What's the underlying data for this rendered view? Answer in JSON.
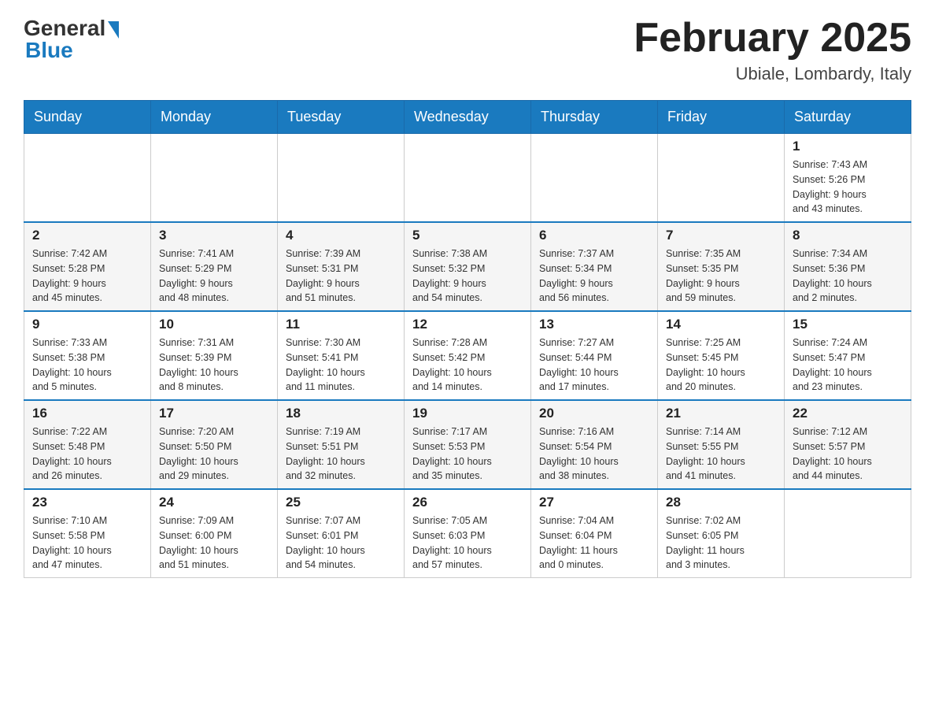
{
  "header": {
    "logo_general": "General",
    "logo_blue": "Blue",
    "month_year": "February 2025",
    "location": "Ubiale, Lombardy, Italy"
  },
  "weekdays": [
    "Sunday",
    "Monday",
    "Tuesday",
    "Wednesday",
    "Thursday",
    "Friday",
    "Saturday"
  ],
  "weeks": [
    [
      {
        "day": "",
        "info": ""
      },
      {
        "day": "",
        "info": ""
      },
      {
        "day": "",
        "info": ""
      },
      {
        "day": "",
        "info": ""
      },
      {
        "day": "",
        "info": ""
      },
      {
        "day": "",
        "info": ""
      },
      {
        "day": "1",
        "info": "Sunrise: 7:43 AM\nSunset: 5:26 PM\nDaylight: 9 hours\nand 43 minutes."
      }
    ],
    [
      {
        "day": "2",
        "info": "Sunrise: 7:42 AM\nSunset: 5:28 PM\nDaylight: 9 hours\nand 45 minutes."
      },
      {
        "day": "3",
        "info": "Sunrise: 7:41 AM\nSunset: 5:29 PM\nDaylight: 9 hours\nand 48 minutes."
      },
      {
        "day": "4",
        "info": "Sunrise: 7:39 AM\nSunset: 5:31 PM\nDaylight: 9 hours\nand 51 minutes."
      },
      {
        "day": "5",
        "info": "Sunrise: 7:38 AM\nSunset: 5:32 PM\nDaylight: 9 hours\nand 54 minutes."
      },
      {
        "day": "6",
        "info": "Sunrise: 7:37 AM\nSunset: 5:34 PM\nDaylight: 9 hours\nand 56 minutes."
      },
      {
        "day": "7",
        "info": "Sunrise: 7:35 AM\nSunset: 5:35 PM\nDaylight: 9 hours\nand 59 minutes."
      },
      {
        "day": "8",
        "info": "Sunrise: 7:34 AM\nSunset: 5:36 PM\nDaylight: 10 hours\nand 2 minutes."
      }
    ],
    [
      {
        "day": "9",
        "info": "Sunrise: 7:33 AM\nSunset: 5:38 PM\nDaylight: 10 hours\nand 5 minutes."
      },
      {
        "day": "10",
        "info": "Sunrise: 7:31 AM\nSunset: 5:39 PM\nDaylight: 10 hours\nand 8 minutes."
      },
      {
        "day": "11",
        "info": "Sunrise: 7:30 AM\nSunset: 5:41 PM\nDaylight: 10 hours\nand 11 minutes."
      },
      {
        "day": "12",
        "info": "Sunrise: 7:28 AM\nSunset: 5:42 PM\nDaylight: 10 hours\nand 14 minutes."
      },
      {
        "day": "13",
        "info": "Sunrise: 7:27 AM\nSunset: 5:44 PM\nDaylight: 10 hours\nand 17 minutes."
      },
      {
        "day": "14",
        "info": "Sunrise: 7:25 AM\nSunset: 5:45 PM\nDaylight: 10 hours\nand 20 minutes."
      },
      {
        "day": "15",
        "info": "Sunrise: 7:24 AM\nSunset: 5:47 PM\nDaylight: 10 hours\nand 23 minutes."
      }
    ],
    [
      {
        "day": "16",
        "info": "Sunrise: 7:22 AM\nSunset: 5:48 PM\nDaylight: 10 hours\nand 26 minutes."
      },
      {
        "day": "17",
        "info": "Sunrise: 7:20 AM\nSunset: 5:50 PM\nDaylight: 10 hours\nand 29 minutes."
      },
      {
        "day": "18",
        "info": "Sunrise: 7:19 AM\nSunset: 5:51 PM\nDaylight: 10 hours\nand 32 minutes."
      },
      {
        "day": "19",
        "info": "Sunrise: 7:17 AM\nSunset: 5:53 PM\nDaylight: 10 hours\nand 35 minutes."
      },
      {
        "day": "20",
        "info": "Sunrise: 7:16 AM\nSunset: 5:54 PM\nDaylight: 10 hours\nand 38 minutes."
      },
      {
        "day": "21",
        "info": "Sunrise: 7:14 AM\nSunset: 5:55 PM\nDaylight: 10 hours\nand 41 minutes."
      },
      {
        "day": "22",
        "info": "Sunrise: 7:12 AM\nSunset: 5:57 PM\nDaylight: 10 hours\nand 44 minutes."
      }
    ],
    [
      {
        "day": "23",
        "info": "Sunrise: 7:10 AM\nSunset: 5:58 PM\nDaylight: 10 hours\nand 47 minutes."
      },
      {
        "day": "24",
        "info": "Sunrise: 7:09 AM\nSunset: 6:00 PM\nDaylight: 10 hours\nand 51 minutes."
      },
      {
        "day": "25",
        "info": "Sunrise: 7:07 AM\nSunset: 6:01 PM\nDaylight: 10 hours\nand 54 minutes."
      },
      {
        "day": "26",
        "info": "Sunrise: 7:05 AM\nSunset: 6:03 PM\nDaylight: 10 hours\nand 57 minutes."
      },
      {
        "day": "27",
        "info": "Sunrise: 7:04 AM\nSunset: 6:04 PM\nDaylight: 11 hours\nand 0 minutes."
      },
      {
        "day": "28",
        "info": "Sunrise: 7:02 AM\nSunset: 6:05 PM\nDaylight: 11 hours\nand 3 minutes."
      },
      {
        "day": "",
        "info": ""
      }
    ]
  ],
  "colors": {
    "header_bg": "#1a7abf",
    "border": "#ccc",
    "top_border": "#1a7abf"
  }
}
